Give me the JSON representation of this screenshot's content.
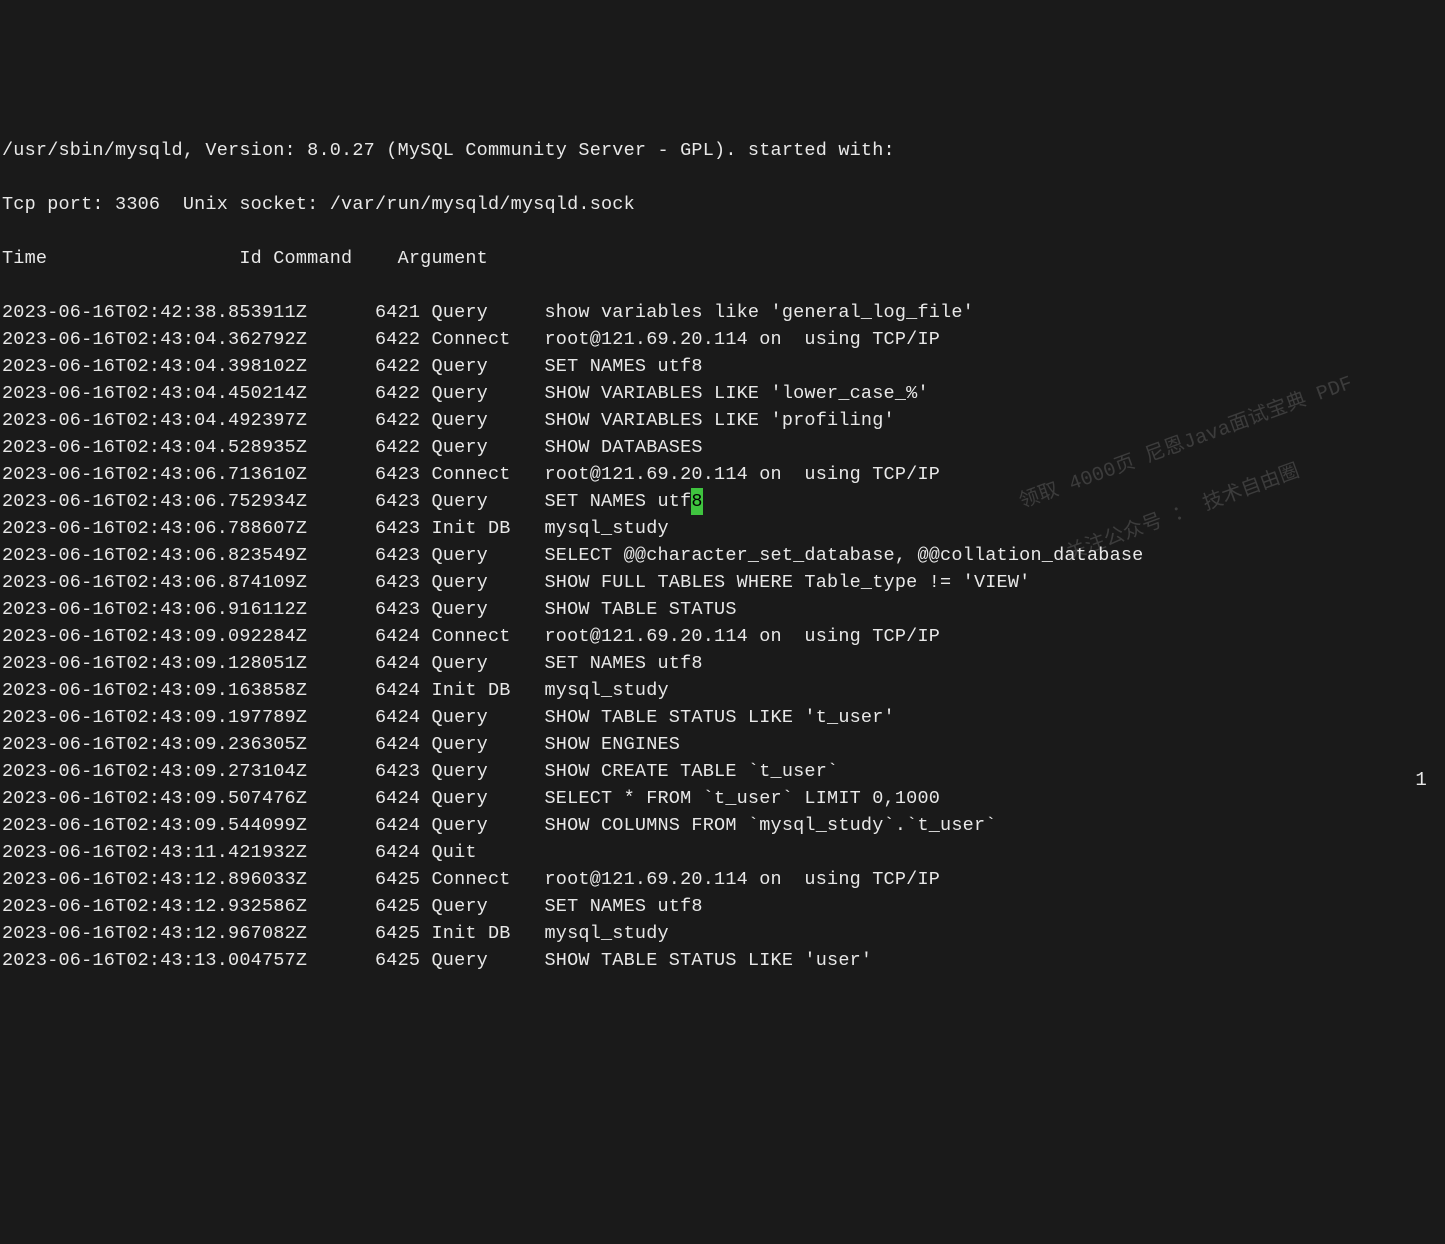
{
  "header": {
    "line1": "/usr/sbin/mysqld, Version: 8.0.27 (MySQL Community Server - GPL). started with:",
    "line2": "Tcp port: 3306  Unix socket: /var/run/mysqld/mysqld.sock",
    "columns": "Time                 Id Command    Argument"
  },
  "rows": [
    {
      "time": "2023-06-16T02:42:38.853911Z",
      "id": "6421",
      "cmd": "Query",
      "arg": "show variables like 'general_log_file'"
    },
    {
      "time": "2023-06-16T02:43:04.362792Z",
      "id": "6422",
      "cmd": "Connect",
      "arg": "root@121.69.20.114 on  using TCP/IP"
    },
    {
      "time": "2023-06-16T02:43:04.398102Z",
      "id": "6422",
      "cmd": "Query",
      "arg": "SET NAMES utf8"
    },
    {
      "time": "2023-06-16T02:43:04.450214Z",
      "id": "6422",
      "cmd": "Query",
      "arg": "SHOW VARIABLES LIKE 'lower_case_%'"
    },
    {
      "time": "2023-06-16T02:43:04.492397Z",
      "id": "6422",
      "cmd": "Query",
      "arg": "SHOW VARIABLES LIKE 'profiling'"
    },
    {
      "time": "2023-06-16T02:43:04.528935Z",
      "id": "6422",
      "cmd": "Query",
      "arg": "SHOW DATABASES"
    },
    {
      "time": "2023-06-16T02:43:06.713610Z",
      "id": "6423",
      "cmd": "Connect",
      "arg": "root@121.69.20.114 on  using TCP/IP"
    },
    {
      "time": "2023-06-16T02:43:06.752934Z",
      "id": "6423",
      "cmd": "Query",
      "arg": "SET NAMES utf",
      "cursor": "8"
    },
    {
      "time": "2023-06-16T02:43:06.788607Z",
      "id": "6423",
      "cmd": "Init DB",
      "arg": "mysql_study"
    },
    {
      "time": "2023-06-16T02:43:06.823549Z",
      "id": "6423",
      "cmd": "Query",
      "arg": "SELECT @@character_set_database, @@collation_database"
    },
    {
      "time": "2023-06-16T02:43:06.874109Z",
      "id": "6423",
      "cmd": "Query",
      "arg": "SHOW FULL TABLES WHERE Table_type != 'VIEW'"
    },
    {
      "time": "2023-06-16T02:43:06.916112Z",
      "id": "6423",
      "cmd": "Query",
      "arg": "SHOW TABLE STATUS"
    },
    {
      "time": "2023-06-16T02:43:09.092284Z",
      "id": "6424",
      "cmd": "Connect",
      "arg": "root@121.69.20.114 on  using TCP/IP"
    },
    {
      "time": "2023-06-16T02:43:09.128051Z",
      "id": "6424",
      "cmd": "Query",
      "arg": "SET NAMES utf8"
    },
    {
      "time": "2023-06-16T02:43:09.163858Z",
      "id": "6424",
      "cmd": "Init DB",
      "arg": "mysql_study"
    },
    {
      "time": "2023-06-16T02:43:09.197789Z",
      "id": "6424",
      "cmd": "Query",
      "arg": "SHOW TABLE STATUS LIKE 't_user'"
    },
    {
      "time": "2023-06-16T02:43:09.236305Z",
      "id": "6424",
      "cmd": "Query",
      "arg": "SHOW ENGINES"
    },
    {
      "time": "2023-06-16T02:43:09.273104Z",
      "id": "6423",
      "cmd": "Query",
      "arg": "SHOW CREATE TABLE `t_user`"
    },
    {
      "time": "2023-06-16T02:43:09.507476Z",
      "id": "6424",
      "cmd": "Query",
      "arg": "SELECT * FROM `t_user` LIMIT 0,1000"
    },
    {
      "time": "2023-06-16T02:43:09.544099Z",
      "id": "6424",
      "cmd": "Query",
      "arg": "SHOW COLUMNS FROM `mysql_study`.`t_user`"
    },
    {
      "time": "2023-06-16T02:43:11.421932Z",
      "id": "6424",
      "cmd": "Quit",
      "arg": ""
    },
    {
      "time": "2023-06-16T02:43:12.896033Z",
      "id": "6425",
      "cmd": "Connect",
      "arg": "root@121.69.20.114 on  using TCP/IP"
    },
    {
      "time": "2023-06-16T02:43:12.932586Z",
      "id": "6425",
      "cmd": "Query",
      "arg": "SET NAMES utf8"
    },
    {
      "time": "2023-06-16T02:43:12.967082Z",
      "id": "6425",
      "cmd": "Init DB",
      "arg": "mysql_study"
    },
    {
      "time": "2023-06-16T02:43:13.004757Z",
      "id": "6425",
      "cmd": "Query",
      "arg": "SHOW TABLE STATUS LIKE 'user'"
    }
  ],
  "watermark": {
    "line1": "领取 4000页 尼恩Java面试宝典 PDF",
    "line2": "关注公众号 ： 技术自由圈"
  },
  "page_number": "1"
}
